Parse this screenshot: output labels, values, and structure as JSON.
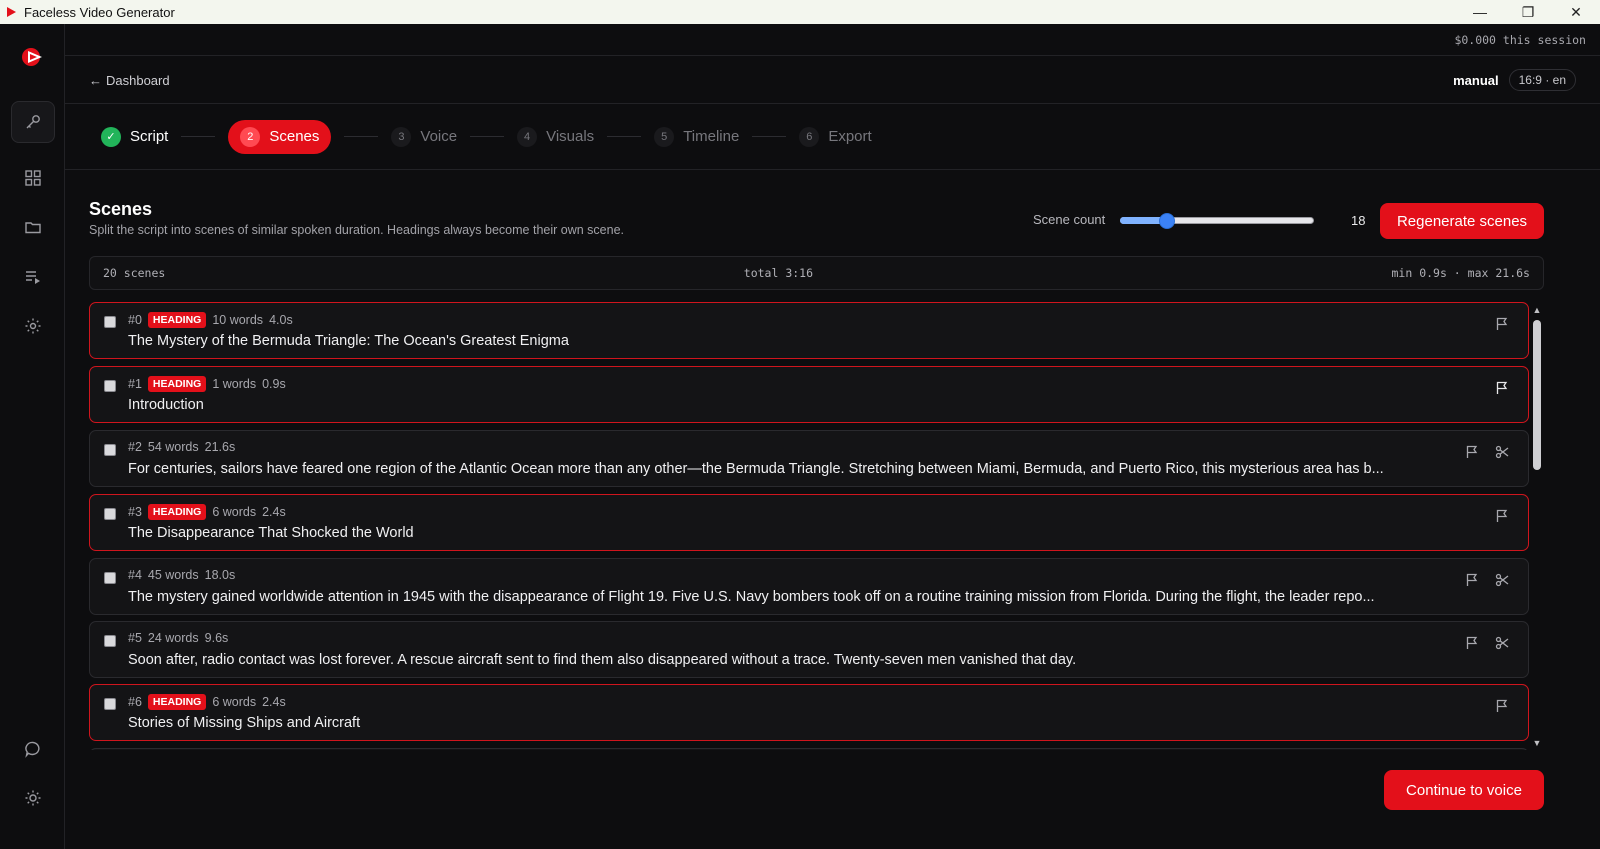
{
  "window": {
    "title": "Faceless Video Generator",
    "minimize": "—",
    "restore": "❐",
    "close": "✕"
  },
  "session": {
    "cost": "$0.000 this session"
  },
  "header": {
    "back_label": "Dashboard",
    "mode": "manual",
    "aspect": "16:9 · en"
  },
  "steps": [
    {
      "num": "✓",
      "label": "Script"
    },
    {
      "num": "2",
      "label": "Scenes"
    },
    {
      "num": "3",
      "label": "Voice"
    },
    {
      "num": "4",
      "label": "Visuals"
    },
    {
      "num": "5",
      "label": "Timeline"
    },
    {
      "num": "6",
      "label": "Export"
    }
  ],
  "scenes_section": {
    "title": "Scenes",
    "subtitle": "Split the script into scenes of similar spoken duration. Headings always become their own scene.",
    "scene_count_label": "Scene count",
    "scene_count_value": "18",
    "slider_fraction": 0.22,
    "regenerate_label": "Regenerate scenes",
    "stats": {
      "count": "20 scenes",
      "total": "total 3:16",
      "range": "min 0.9s · max 21.6s"
    }
  },
  "scenes": [
    {
      "id": "#0",
      "badge": "HEADING",
      "words": "10 words",
      "dur": "4.0s",
      "text": "The Mystery of the Bermuda Triangle: The Ocean's Greatest Enigma"
    },
    {
      "id": "#1",
      "badge": "HEADING",
      "words": "1 words",
      "dur": "0.9s",
      "text": "Introduction"
    },
    {
      "id": "#2",
      "badge": "",
      "words": "54 words",
      "dur": "21.6s",
      "text": "For centuries, sailors have feared one region of the Atlantic Ocean more than any other—the Bermuda Triangle. Stretching between Miami, Bermuda, and Puerto Rico, this mysterious area has b..."
    },
    {
      "id": "#3",
      "badge": "HEADING",
      "words": "6 words",
      "dur": "2.4s",
      "text": "The Disappearance That Shocked the World"
    },
    {
      "id": "#4",
      "badge": "",
      "words": "45 words",
      "dur": "18.0s",
      "text": "The mystery gained worldwide attention in 1945 with the disappearance of Flight 19. Five U.S. Navy bombers took off on a routine training mission from Florida. During the flight, the leader repo..."
    },
    {
      "id": "#5",
      "badge": "",
      "words": "24 words",
      "dur": "9.6s",
      "text": "Soon after, radio contact was lost forever. A rescue aircraft sent to find them also disappeared without a trace. Twenty-seven men vanished that day."
    },
    {
      "id": "#6",
      "badge": "HEADING",
      "words": "6 words",
      "dur": "2.4s",
      "text": "Stories of Missing Ships and Aircraft"
    }
  ],
  "footer": {
    "continue_label": "Continue to voice"
  },
  "colors": {
    "accent": "#e3101a",
    "done": "#22b45a",
    "slider": "#3b82f6"
  }
}
